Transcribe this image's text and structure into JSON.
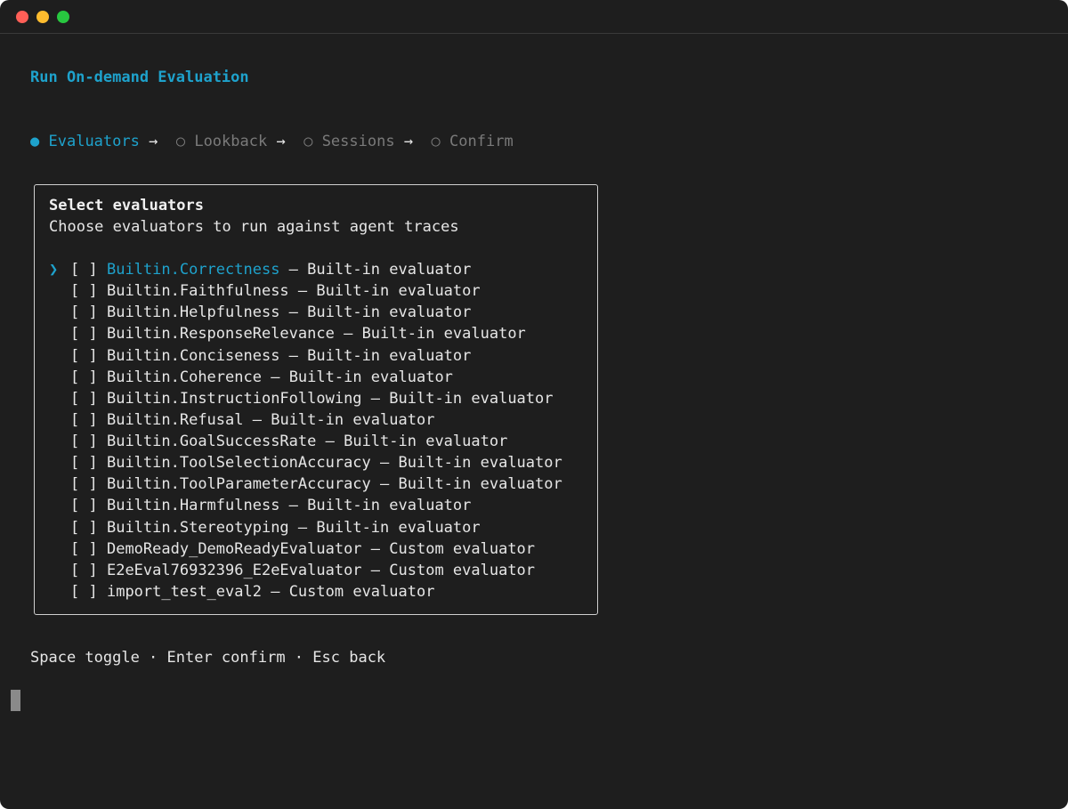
{
  "title": "Run On-demand Evaluation",
  "steps": {
    "active_bullet": "●",
    "inactive_bullet": "○",
    "arrow": "→",
    "items": [
      "Evaluators",
      "Lookback",
      "Sessions",
      "Confirm"
    ],
    "active_index": 0
  },
  "panel": {
    "title": "Select evaluators",
    "subtitle": "Choose evaluators to run against agent traces",
    "pointer": "❯",
    "checkbox": "[ ]",
    "items": [
      {
        "name": "Builtin.Correctness",
        "desc": "Built-in evaluator",
        "focused": true
      },
      {
        "name": "Builtin.Faithfulness",
        "desc": "Built-in evaluator"
      },
      {
        "name": "Builtin.Helpfulness",
        "desc": "Built-in evaluator"
      },
      {
        "name": "Builtin.ResponseRelevance",
        "desc": "Built-in evaluator"
      },
      {
        "name": "Builtin.Conciseness",
        "desc": "Built-in evaluator"
      },
      {
        "name": "Builtin.Coherence",
        "desc": "Built-in evaluator"
      },
      {
        "name": "Builtin.InstructionFollowing",
        "desc": "Built-in evaluator"
      },
      {
        "name": "Builtin.Refusal",
        "desc": "Built-in evaluator"
      },
      {
        "name": "Builtin.GoalSuccessRate",
        "desc": "Built-in evaluator"
      },
      {
        "name": "Builtin.ToolSelectionAccuracy",
        "desc": "Built-in evaluator"
      },
      {
        "name": "Builtin.ToolParameterAccuracy",
        "desc": "Built-in evaluator"
      },
      {
        "name": "Builtin.Harmfulness",
        "desc": "Built-in evaluator"
      },
      {
        "name": "Builtin.Stereotyping",
        "desc": "Built-in evaluator"
      },
      {
        "name": "DemoReady_DemoReadyEvaluator",
        "desc": "Custom evaluator"
      },
      {
        "name": "E2eEval76932396_E2eEvaluator",
        "desc": "Custom evaluator"
      },
      {
        "name": "import_test_eval2",
        "desc": "Custom evaluator"
      }
    ]
  },
  "hint": "Space toggle · Enter confirm · Esc back",
  "colors": {
    "background": "#1e1e1e",
    "accent": "#1ea2cc",
    "text": "#e6e6e6",
    "muted": "#7a7a7a"
  }
}
